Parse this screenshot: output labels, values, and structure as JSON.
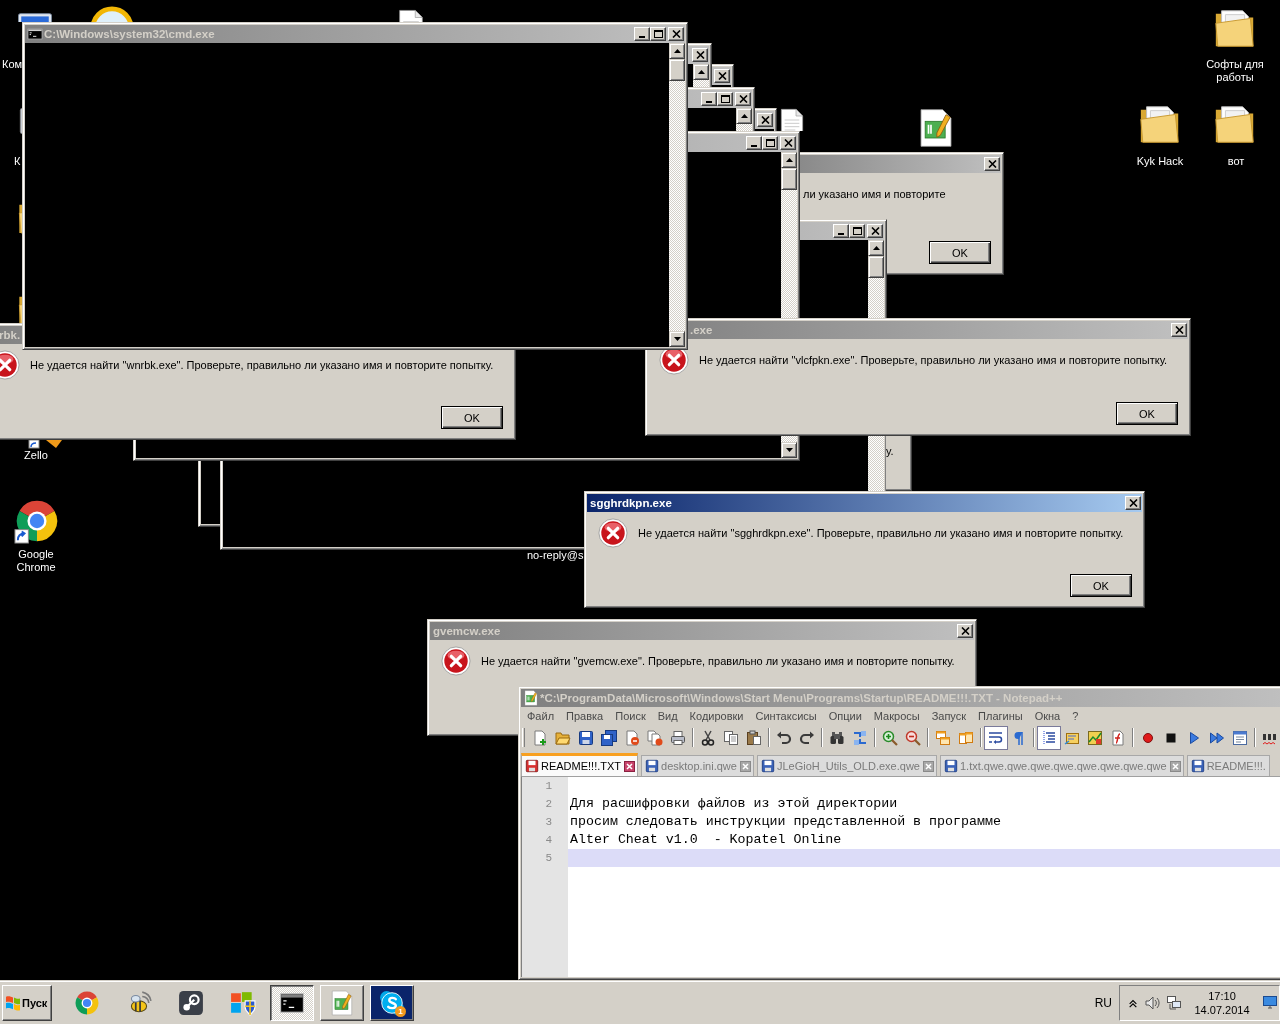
{
  "desktop": {
    "icons": [
      {
        "kind": "computer",
        "label": "Ком"
      },
      {
        "kind": "program",
        "label": "К"
      },
      {
        "kind": "folder"
      },
      {
        "kind": "folder"
      },
      {
        "kind": "app",
        "label": "Zello"
      },
      {
        "kind": "browser",
        "label": "Google Chrome"
      },
      {
        "kind": "ring"
      },
      {
        "kind": "document"
      },
      {
        "kind": "document"
      },
      {
        "kind": "notepad-document"
      },
      {
        "kind": "folder",
        "label": "Софты для работы"
      },
      {
        "kind": "folder",
        "label": "Kyk Hack"
      },
      {
        "kind": "folder",
        "label": "вот"
      }
    ],
    "note": "no-reply@s"
  },
  "windows": [
    {
      "kind": "console"
    },
    {
      "kind": "dialog",
      "message": "ли указано имя и повторите",
      "button": "OK",
      "active": false
    },
    {
      "kind": "console",
      "active": false
    },
    {
      "kind": "dialog",
      "message": "у."
    },
    {
      "kind": "console",
      "active": false
    },
    {
      "kind": "console",
      "active": false
    },
    {
      "kind": "console",
      "active": false
    },
    {
      "kind": "console",
      "active": false
    },
    {
      "kind": "console",
      "active": false
    },
    {
      "kind": "dialog",
      "title": "rbk.",
      "message": "Не удается найти \"wnrbk.exe\". Проверьте, правильно ли указано имя и повторите попытку.",
      "button": "OK",
      "active": false
    },
    {
      "kind": "dialog",
      "title": ".exe",
      "message": "Не удается найти \"vlcfpkn.exe\". Проверьте, правильно ли указано имя и повторите попытку.",
      "button": "OK",
      "active": false
    },
    {
      "kind": "console",
      "title": "C:\\Windows\\system32\\cmd.exe",
      "active": false
    },
    {
      "kind": "dialog",
      "title": "sgghrdkpn.exe",
      "message": "Не удается найти \"sgghrdkpn.exe\". Проверьте, правильно ли указано имя и повторите попытку.",
      "button": "OK",
      "active": true
    },
    {
      "kind": "dialog",
      "title": "gvemcw.exe",
      "message": "Не удается найти \"gvemcw.exe\". Проверьте, правильно ли указано имя и повторите попытку.",
      "active": false
    },
    {
      "kind": "editor",
      "title": "*C:\\ProgramData\\Microsoft\\Windows\\Start Menu\\Programs\\Startup\\README!!!.TXT - Notepad++",
      "active": false,
      "menu": [
        "Файл",
        "Правка",
        "Поиск",
        "Вид",
        "Кодировки",
        "Синтаксисы",
        "Опции",
        "Макросы",
        "Запуск",
        "Плагины",
        "Окна",
        "?"
      ],
      "toolbar": [
        [
          {
            "kind": "new",
            "on": false
          },
          {
            "kind": "open",
            "on": false
          },
          {
            "kind": "save",
            "on": false
          },
          {
            "kind": "saveall",
            "on": false
          },
          {
            "kind": "close",
            "on": false
          },
          {
            "kind": "closeall",
            "on": false
          },
          {
            "kind": "print",
            "on": false
          }
        ],
        [
          {
            "kind": "cut",
            "on": false
          },
          {
            "kind": "copy",
            "on": false
          },
          {
            "kind": "paste",
            "on": false
          }
        ],
        [
          {
            "kind": "undo",
            "on": false
          },
          {
            "kind": "redo",
            "on": false
          }
        ],
        [
          {
            "kind": "find",
            "on": false
          },
          {
            "kind": "replace",
            "on": false
          }
        ],
        [
          {
            "kind": "zoomin",
            "on": false
          },
          {
            "kind": "zoomout",
            "on": false
          }
        ],
        [
          {
            "kind": "syncv",
            "on": false
          },
          {
            "kind": "synch",
            "on": false
          }
        ],
        [
          {
            "kind": "wrap",
            "on": true
          },
          {
            "kind": "allchars",
            "on": false
          }
        ],
        [
          {
            "kind": "indent",
            "on": true
          },
          {
            "kind": "docmap",
            "on": false
          },
          {
            "kind": "map",
            "on": false
          },
          {
            "kind": "func",
            "on": false
          }
        ],
        [
          {
            "kind": "record",
            "on": false
          },
          {
            "kind": "stop",
            "on": false
          },
          {
            "kind": "play",
            "on": false
          },
          {
            "kind": "playmulti",
            "on": false
          },
          {
            "kind": "savemacro",
            "on": false
          }
        ],
        [
          {
            "kind": "spell",
            "on": false
          }
        ]
      ],
      "tabs": [
        {
          "label": "README!!!.TXT",
          "selected": true,
          "modified": true
        },
        {
          "label": "desktop.ini.qwe",
          "selected": false,
          "modified": false
        },
        {
          "label": "JLeGioH_Utils_OLD.exe.qwe",
          "selected": false,
          "modified": false
        },
        {
          "label": "1.txt.qwe.qwe.qwe.qwe.qwe.qwe.qwe.qwe",
          "selected": false,
          "modified": false
        },
        {
          "label": "README!!!.",
          "selected": false,
          "modified": false
        }
      ],
      "lines": [
        {
          "number": "1",
          "current": false
        },
        {
          "number": "2",
          "text": "Для расшифровки файлов из этой директории",
          "current": false
        },
        {
          "number": "3",
          "text": "просим следовать инструкции представленной в программе",
          "current": false
        },
        {
          "number": "4",
          "text": "Alter Cheat v1.0  - Kopatel Online",
          "current": false
        },
        {
          "number": "5",
          "current": true
        }
      ]
    }
  ],
  "taskbar": {
    "start": "Пуск",
    "quick_launch": [
      {
        "kind": "browser"
      },
      {
        "kind": "bee"
      },
      {
        "kind": "piston"
      },
      {
        "kind": "shield"
      }
    ],
    "buttons": [
      {
        "kind": "console",
        "selected": true,
        "flashing": false
      },
      {
        "kind": "notepad",
        "selected": false,
        "flashing": false
      },
      {
        "kind": "messenger",
        "selected": false,
        "flashing": true,
        "badge": "1"
      }
    ],
    "language": "RU",
    "tray": [
      {
        "kind": "chevron"
      },
      {
        "kind": "speaker"
      },
      {
        "kind": "network"
      }
    ],
    "time": "17:10",
    "date": "14.07.2014"
  }
}
